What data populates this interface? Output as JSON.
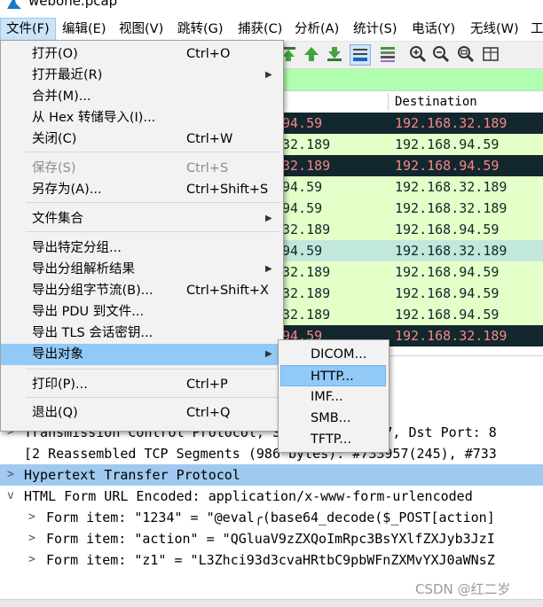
{
  "window": {
    "title": "webone.pcap",
    "icon": "wireshark-fin-icon"
  },
  "menubar": [
    {
      "label": "文件(F)",
      "active": true
    },
    {
      "label": "编辑(E)"
    },
    {
      "label": "视图(V)"
    },
    {
      "label": "跳转(G)"
    },
    {
      "label": "捕获(C)"
    },
    {
      "label": "分析(A)"
    },
    {
      "label": "统计(S)"
    },
    {
      "label": "电话(Y)"
    },
    {
      "label": "无线(W)"
    },
    {
      "label": "工"
    }
  ],
  "toolbar_icons": [
    "go-first-packet-icon",
    "go-last-packet-icon",
    "auto-scroll-icon",
    "colorize-icon",
    "zoom-in-icon",
    "zoom-out-icon",
    "zoom-normal-icon",
    "resize-columns-icon"
  ],
  "packet_list": {
    "columns": {
      "destination": "Destination"
    },
    "rows": [
      {
        "src": "94.59",
        "dst": "192.168.32.189",
        "bg": "#12272e",
        "fg": "#f78787"
      },
      {
        "src": "32.189",
        "dst": "192.168.94.59",
        "bg": "#e4ffc7",
        "fg": "#12272e"
      },
      {
        "src": "32.189",
        "dst": "192.168.94.59",
        "bg": "#12272e",
        "fg": "#f78787"
      },
      {
        "src": "94.59",
        "dst": "192.168.32.189",
        "bg": "#e4ffc7",
        "fg": "#12272e"
      },
      {
        "src": "94.59",
        "dst": "192.168.32.189",
        "bg": "#e4ffc7",
        "fg": "#12272e"
      },
      {
        "src": "32.189",
        "dst": "192.168.94.59",
        "bg": "#e4ffc7",
        "fg": "#12272e"
      },
      {
        "src": "94.59",
        "dst": "192.168.32.189",
        "bg": "#c2e8dc",
        "fg": "#12272e"
      },
      {
        "src": "32.189",
        "dst": "192.168.94.59",
        "bg": "#e4ffc7",
        "fg": "#12272e"
      },
      {
        "src": "32.189",
        "dst": "192.168.94.59",
        "bg": "#e4ffc7",
        "fg": "#12272e"
      },
      {
        "src": "32.189",
        "dst": "192.168.94.59",
        "bg": "#e4ffc7",
        "fg": "#12272e"
      },
      {
        "src": "94.59",
        "dst": "192.168.32.189",
        "bg": "#12272e",
        "fg": "#f78787"
      }
    ]
  },
  "details": [
    {
      "arrow": "",
      "text": "                s), 795 bytes capt",
      "sub": false
    },
    {
      "arrow": "",
      "text": "                9:63:39:42:ed), Ds",
      "sub": false
    },
    {
      "arrow": "",
      "text": "                .94.59, Dst: 192.1",
      "sub": false
    },
    {
      "arrow": ">",
      "text": "Transmission Control Protocol, Src Port: 12867, Dst Port: 8",
      "sub": false
    },
    {
      "arrow": "",
      "text": "[2 Reassembled TCP Segments (986 bytes): #733957(245), #733",
      "sub": false
    },
    {
      "arrow": ">",
      "text": "Hypertext Transfer Protocol",
      "sub": false,
      "highlight": true
    },
    {
      "arrow": "v",
      "text": "HTML Form URL Encoded: application/x-www-form-urlencoded",
      "sub": false
    },
    {
      "arrow": ">",
      "text": "Form item: \"1234\" = \"@eval╭(base64_decode($_POST[action]",
      "sub": true
    },
    {
      "arrow": ">",
      "text": "Form item: \"action\" = \"QGluaV9zZXQoImRpc3BsYXlfZXJyb3JzI",
      "sub": true
    },
    {
      "arrow": ">",
      "text": "Form item: \"z1\" = \"L3Zhci93d3cvaHRtbC9pbWFnZXMvYXJ0aWNsZ",
      "sub": true
    }
  ],
  "file_menu": [
    {
      "label": "打开(O)",
      "shortcut": "Ctrl+O"
    },
    {
      "label": "打开最近(R)",
      "submenu": true
    },
    {
      "label": "合并(M)..."
    },
    {
      "label": "从 Hex 转储导入(I)..."
    },
    {
      "label": "关闭(C)",
      "shortcut": "Ctrl+W"
    },
    {
      "separator": true
    },
    {
      "label": "保存(S)",
      "shortcut": "Ctrl+S",
      "disabled": true
    },
    {
      "label": "另存为(A)...",
      "shortcut": "Ctrl+Shift+S"
    },
    {
      "separator": true
    },
    {
      "label": "文件集合",
      "submenu": true
    },
    {
      "separator": true
    },
    {
      "label": "导出特定分组..."
    },
    {
      "label": "导出分组解析结果",
      "submenu": true
    },
    {
      "label": "导出分组字节流(B)...",
      "shortcut": "Ctrl+Shift+X"
    },
    {
      "label": "导出 PDU 到文件..."
    },
    {
      "label": "导出 TLS 会话密钥..."
    },
    {
      "label": "导出对象",
      "submenu": true,
      "active": true
    },
    {
      "separator": true
    },
    {
      "label": "打印(P)...",
      "shortcut": "Ctrl+P"
    },
    {
      "separator": true
    },
    {
      "label": "退出(Q)",
      "shortcut": "Ctrl+Q"
    }
  ],
  "export_objects_submenu": [
    {
      "label": "DICOM..."
    },
    {
      "label": "HTTP...",
      "active": true
    },
    {
      "label": "IMF..."
    },
    {
      "label": "SMB..."
    },
    {
      "label": "TFTP..."
    }
  ],
  "watermark": "CSDN @红二岁",
  "colors": {
    "menu_highlight": "#91c9f7",
    "filter_ok": "#afffaf",
    "selected_tree": "#9fc9f0"
  }
}
